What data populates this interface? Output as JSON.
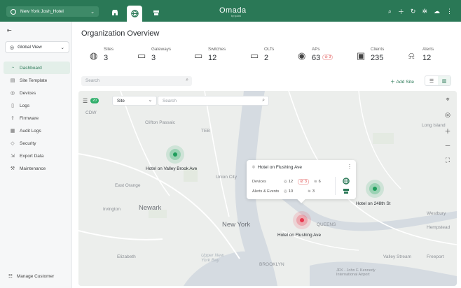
{
  "topbar": {
    "site_name": "New York Josh_Hotel",
    "logo": "Omada",
    "logo_sub": "by tp-link",
    "tabs": [
      "store-icon",
      "globe-icon",
      "router-icon"
    ],
    "active_tab": "globe-icon",
    "icons": [
      "search-icon",
      "plus-icon",
      "refresh-icon",
      "gear-icon",
      "cloud-icon",
      "more-icon"
    ]
  },
  "sidebar": {
    "global_view": "Global View",
    "items": [
      {
        "label": "Dashboard",
        "icon": "dashboard-icon",
        "active": true
      },
      {
        "label": "Site Template",
        "icon": "template-icon"
      },
      {
        "label": "Devices",
        "icon": "devices-icon"
      },
      {
        "label": "Logs",
        "icon": "logs-icon"
      },
      {
        "label": "Firmware",
        "icon": "firmware-icon"
      },
      {
        "label": "Audit Logs",
        "icon": "audit-icon"
      },
      {
        "label": "Security",
        "icon": "shield-icon"
      },
      {
        "label": "Export Data",
        "icon": "export-icon"
      },
      {
        "label": "Maintenance",
        "icon": "wrench-icon"
      }
    ],
    "manage_customer": "Manage Customer"
  },
  "main": {
    "title": "Organization Overview",
    "stats": [
      {
        "label": "Sites",
        "value": "3",
        "icon": "location-icon"
      },
      {
        "label": "Gateways",
        "value": "3",
        "icon": "gateway-icon"
      },
      {
        "label": "Switches",
        "value": "12",
        "icon": "switch-icon"
      },
      {
        "label": "OLTs",
        "value": "2",
        "icon": "olt-icon"
      },
      {
        "label": "APs",
        "value": "63",
        "badge": "3",
        "icon": "ap-icon"
      },
      {
        "label": "Clients",
        "value": "235",
        "icon": "clients-icon"
      },
      {
        "label": "Alerts",
        "value": "12",
        "icon": "alert-icon"
      }
    ],
    "search_placeholder": "Search",
    "add_site": "Add Site"
  },
  "map": {
    "count_badge": "20",
    "select_value": "Site",
    "search_placeholder": "Search",
    "labels": [
      {
        "text": "CDW"
      },
      {
        "text": "Clifton Passaic"
      },
      {
        "text": "TEB"
      },
      {
        "text": "East Orange"
      },
      {
        "text": "Irvington"
      },
      {
        "text": "Newark"
      },
      {
        "text": "Union City"
      },
      {
        "text": "New York"
      },
      {
        "text": "Elizabeth"
      },
      {
        "text": "Upper New York Bay"
      },
      {
        "text": "BROOKLYN"
      },
      {
        "text": "QUEENS"
      },
      {
        "text": "JFK - John F. Kennedy International Airport"
      },
      {
        "text": "Westbury"
      },
      {
        "text": "Hempstead"
      },
      {
        "text": "Valley Stream"
      },
      {
        "text": "Freeport"
      },
      {
        "text": "Long Island"
      }
    ],
    "sites": [
      {
        "name": "Hotel on Valley Brook Ave",
        "status": "ok"
      },
      {
        "name": "Hotel on Flushing Ave",
        "status": "alert"
      },
      {
        "name": "Hotel on 248th St",
        "status": "ok"
      }
    ],
    "popup": {
      "title": "Hotel on Flushing Ave",
      "devices_label": "Devices",
      "devices": {
        "total": "12",
        "offline": "3",
        "aps": "6"
      },
      "alerts_label": "Alerts & Events",
      "alerts": {
        "alerts": "10",
        "events": "3"
      }
    },
    "colors": {
      "accent": "#2a7856",
      "ok": "#1f9d5c",
      "alert": "#e8384f"
    }
  }
}
